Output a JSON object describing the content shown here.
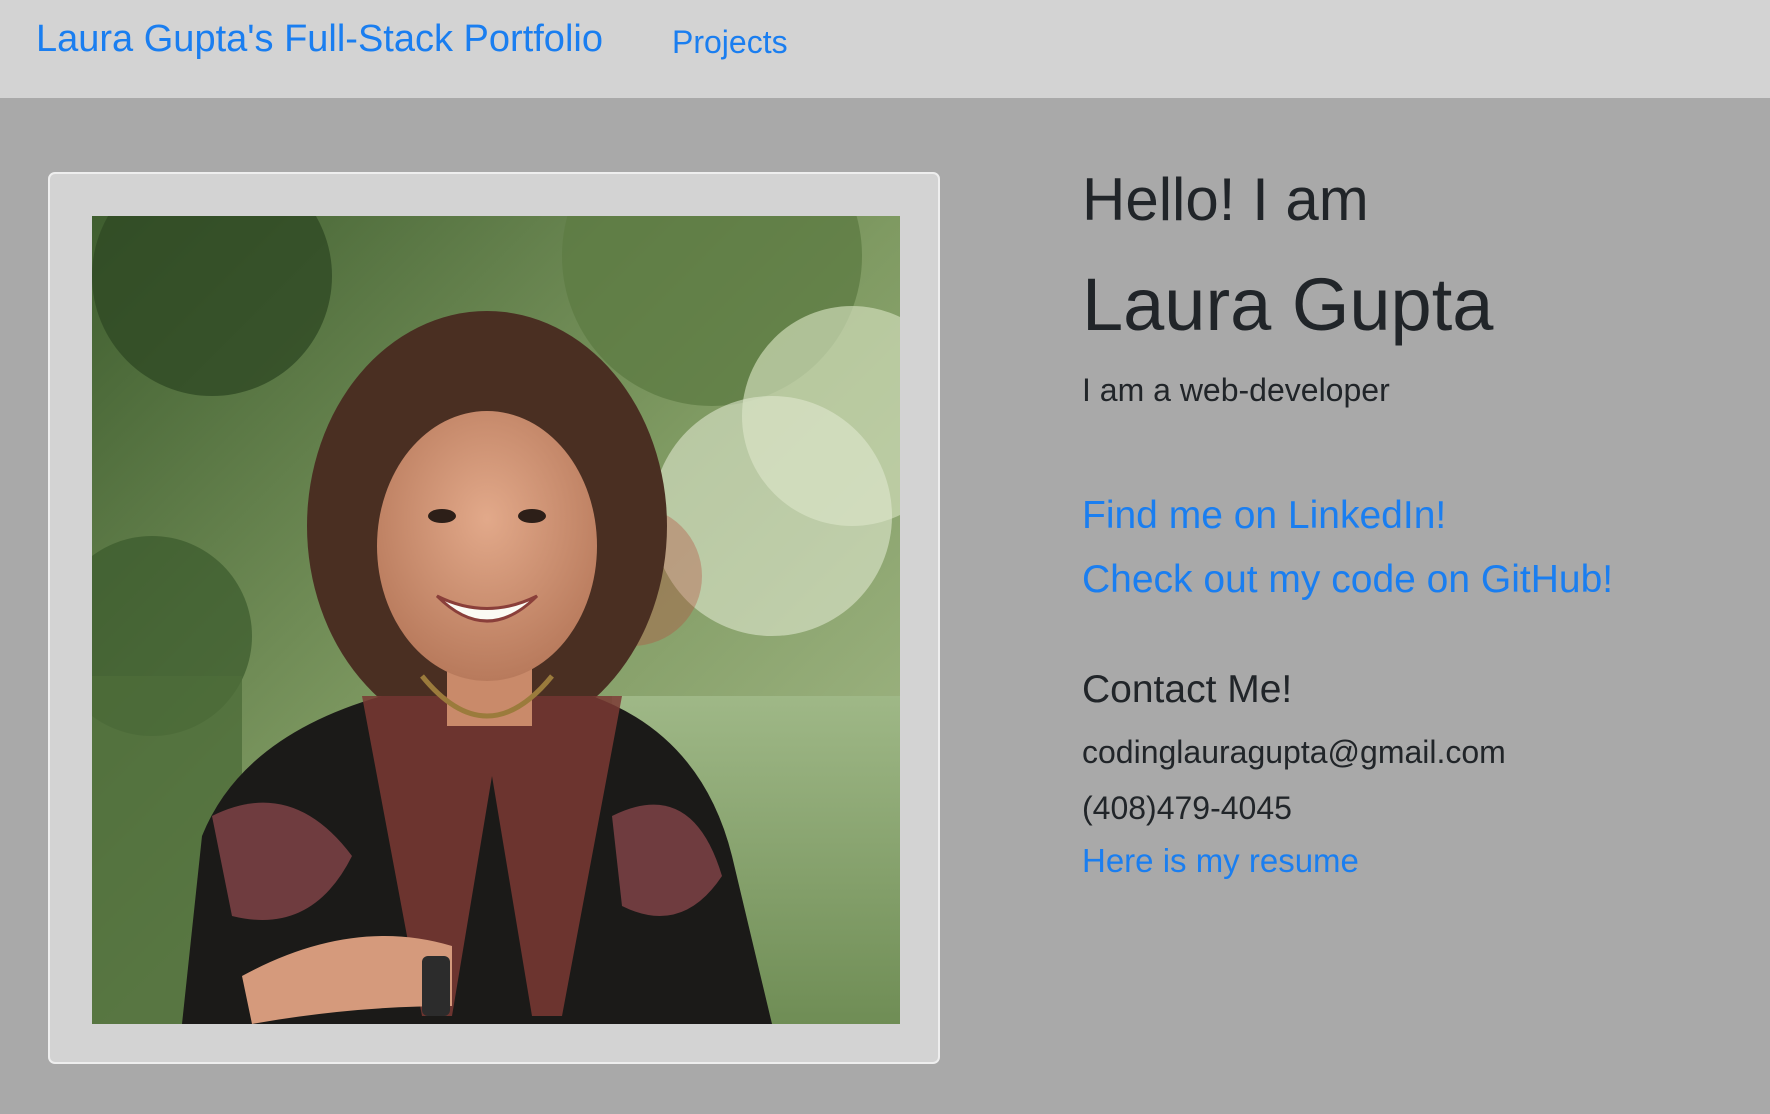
{
  "navbar": {
    "brand": "Laura Gupta's Full-Stack Portfolio",
    "links": [
      {
        "label": "Projects"
      }
    ]
  },
  "profile": {
    "photo_description": "portrait-photo",
    "greeting": "Hello! I am",
    "name": "Laura Gupta",
    "tagline": "I am a web-developer"
  },
  "social": {
    "linkedin_label": "Find me on LinkedIn!",
    "github_label": "Check out my code on GitHub!"
  },
  "contact": {
    "heading": "Contact Me!",
    "email": "codinglauragupta@gmail.com",
    "phone": "(408)479-4045",
    "resume_label": "Here is my resume"
  },
  "colors": {
    "page_background": "#a9a9a9",
    "navbar_background": "#d3d3d3",
    "link": "#1a7ef0",
    "text": "#212529"
  }
}
